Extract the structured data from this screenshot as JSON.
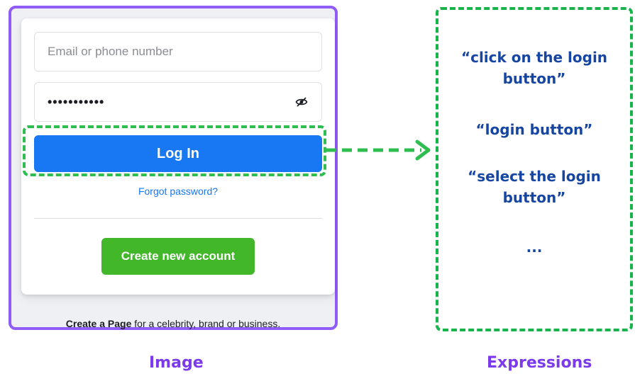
{
  "screenshot": {
    "email_placeholder": "Email or phone number",
    "password_value": "•••••••••••",
    "eye_icon": "eye-slash-icon",
    "login_label": "Log In",
    "forgot_label": "Forgot password?",
    "create_label": "Create new account",
    "footer_bold": "Create a Page",
    "footer_rest": " for a celebrity, brand or business."
  },
  "expressions": [
    "“click on the login button”",
    "“login button”",
    "“select the login button”",
    "..."
  ],
  "captions": {
    "image": "Image",
    "expressions": "Expressions"
  },
  "colors": {
    "frame_purple": "#8f5cf6",
    "highlight_green": "#2ebd4f",
    "login_blue": "#1877f2",
    "create_green": "#42b72a",
    "expression_blue": "#1746a2"
  }
}
